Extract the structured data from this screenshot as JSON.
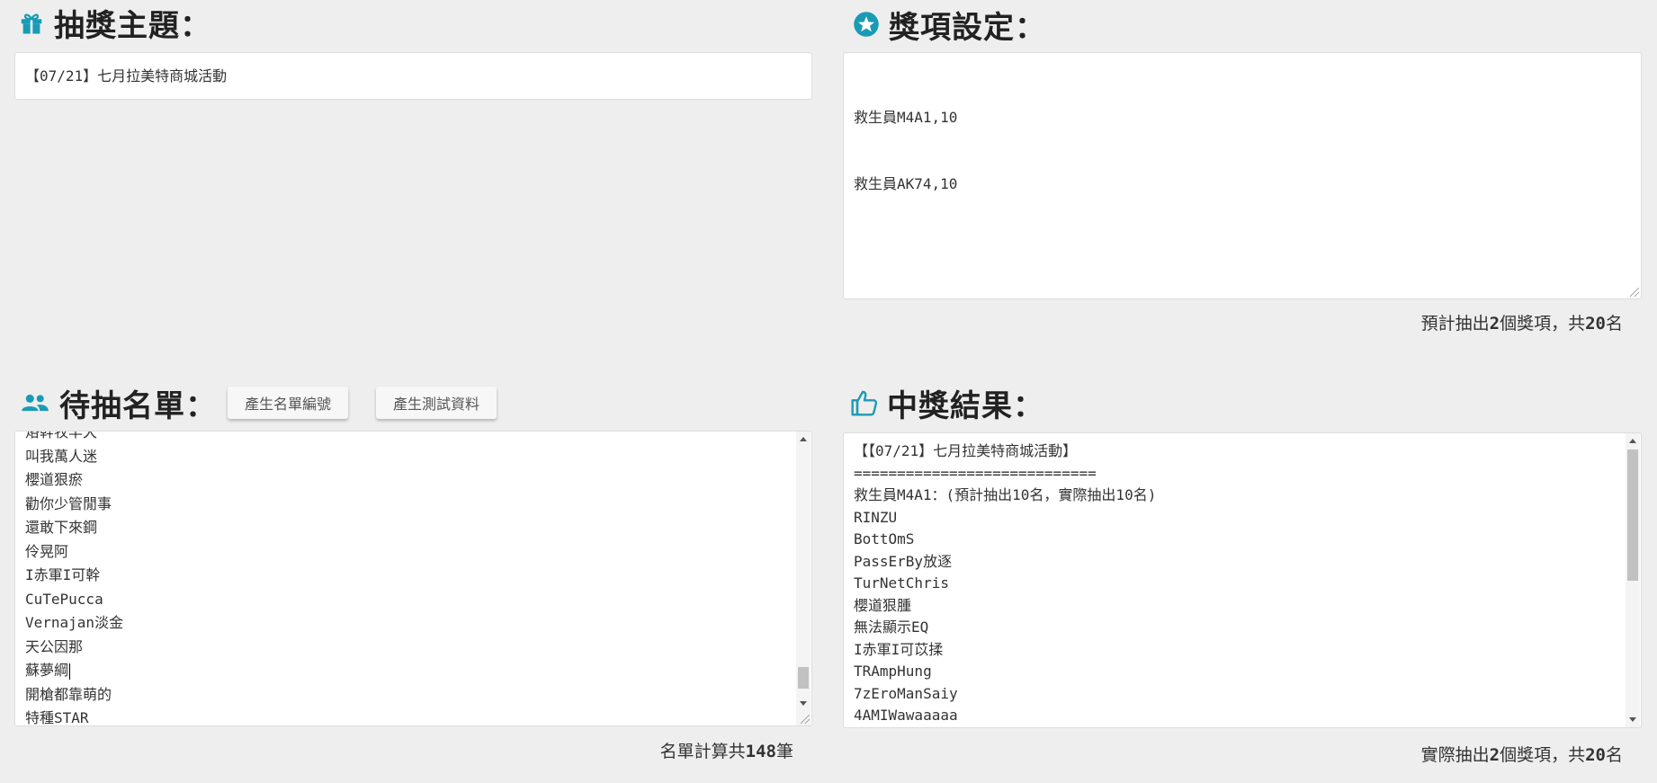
{
  "topic": {
    "title": "抽獎主題：",
    "value": "【07/21】七月拉美特商城活動"
  },
  "prizes": {
    "title": "獎項設定：",
    "lines": [
      "救生員M4A1,10",
      "救生員AK74,10"
    ],
    "summary": {
      "prefix": "預計抽出",
      "count": "2",
      "middle": "個獎項，共",
      "total": "20",
      "suffix": "名"
    }
  },
  "candidates": {
    "title": "待抽名單：",
    "generate_numbers_label": "產生名單編號",
    "generate_test_label": "產生測試資料",
    "lines": [
      "烙幹牧羊犬",
      "叫我萬人迷",
      "櫻道狠瘀",
      "勸你少管閒事",
      "還敢下來鋼",
      "伶晃阿",
      "I赤軍I可幹",
      "CuTePucca",
      "Vernajan淡金",
      "天公因那",
      "蘇夢綱",
      "開槍都靠萌的",
      "特種STAR"
    ],
    "summary": {
      "prefix": "名單計算共",
      "count": "148",
      "suffix": "筆"
    }
  },
  "results": {
    "title": "中獎結果：",
    "lines": [
      "【【07/21】七月拉美特商城活動】",
      "============================",
      "救生員M4A1：(預計抽出10名，實際抽出10名)",
      "RINZU",
      "BottOmS",
      "PassErBy放逐",
      "TurNetChris",
      "櫻道狠腫",
      "無法顯示EQ",
      "I赤軍I可苡揉",
      "TRAmpHung",
      "7zEroManSaiy",
      "4AMIWawaaaaa"
    ],
    "summary": {
      "prefix": "實際抽出",
      "count": "2",
      "middle": "個獎項，共",
      "total": "20",
      "suffix": "名"
    }
  },
  "colors": {
    "icon_teal": "#1a9bb5",
    "background": "#eeeeee"
  },
  "icons": {
    "topic": "gift-icon",
    "prizes": "star-circle-icon",
    "candidates": "people-icon",
    "results": "thumbs-up-icon"
  }
}
